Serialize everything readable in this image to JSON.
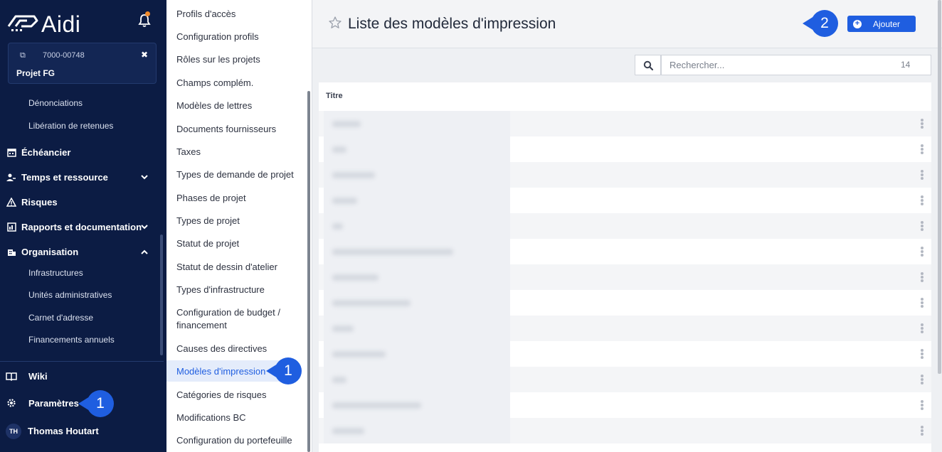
{
  "sidebar": {
    "logo_text": "Aidi",
    "project": {
      "code": "7000-00748",
      "name": "Projet FG"
    },
    "sub_items_top": [
      "Dénonciations",
      "Libération de retenues"
    ],
    "nav": [
      {
        "label": "Échéancier",
        "icon": "calendar-icon"
      },
      {
        "label": "Temps et ressource",
        "icon": "user-clock-icon",
        "chevron": "down"
      },
      {
        "label": "Risques",
        "icon": "warning-icon"
      },
      {
        "label": "Rapports et documentation",
        "icon": "report-icon",
        "chevron": "down"
      },
      {
        "label": "Organisation",
        "icon": "building-icon",
        "chevron": "up"
      }
    ],
    "org_items": [
      "Infrastructures",
      "Unités administratives",
      "Carnet d'adresse",
      "Financements annuels"
    ],
    "wiki_label": "Wiki",
    "settings_label": "Paramètres",
    "user": {
      "initials": "TH",
      "name": "Thomas Houtart"
    }
  },
  "callouts": {
    "settings": "1",
    "print_models": "1",
    "add": "2"
  },
  "settings_menu": [
    "Profils d'accès",
    "Configuration profils",
    "Rôles sur les projets",
    "Champs complém.",
    "Modèles de lettres",
    "Documents fournisseurs",
    "Taxes",
    "Types de demande de projet",
    "Phases de projet",
    "Types de projet",
    "Statut de projet",
    "Statut de dessin d'atelier",
    "Types d'infrastructure",
    "Configuration de budget / financement",
    "Causes des directives",
    "Modèles d'impression",
    "Catégories de risques",
    "Modifications BC",
    "Configuration du portefeuille"
  ],
  "active_menu_item": "Modèles d'impression",
  "main": {
    "title": "Liste des modèles d'impression",
    "add_label": "Ajouter",
    "search_placeholder": "Rechercher...",
    "result_count": "14",
    "column_header": "Titre",
    "row_count": 13
  },
  "colors": {
    "sidebar": "#0c1c44",
    "accent": "#1f5ee0",
    "notification": "#f08a2b"
  }
}
